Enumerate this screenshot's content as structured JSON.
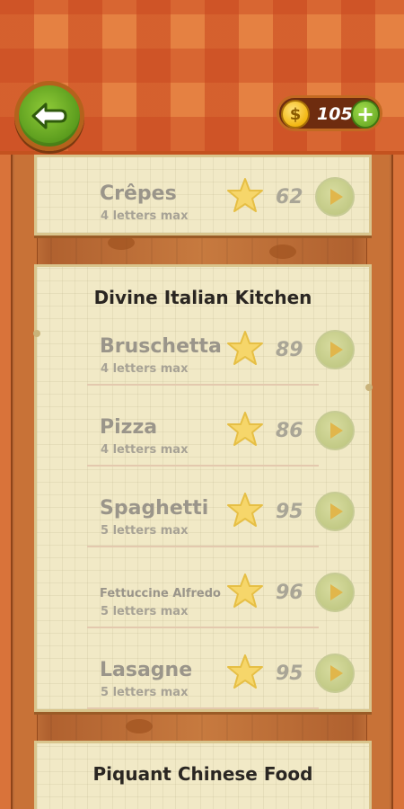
{
  "coins": {
    "value": "105",
    "coin_symbol": "$",
    "plus_symbol": "+"
  },
  "header": {
    "back_icon": "arrow-left-icon"
  },
  "top_partial_level": {
    "name": "Crêpes",
    "sub": "4 letters max",
    "score": "62"
  },
  "section1": {
    "title": "Divine Italian Kitchen",
    "levels": [
      {
        "name": "Bruschetta",
        "sub": "4 letters max",
        "score": "89",
        "small": false
      },
      {
        "name": "Pizza",
        "sub": "4 letters max",
        "score": "86",
        "small": false
      },
      {
        "name": "Spaghetti",
        "sub": "5 letters max",
        "score": "95",
        "small": false
      },
      {
        "name": "Fettuccine Alfredo",
        "sub": "5 letters max",
        "score": "96",
        "small": true
      },
      {
        "name": "Lasagne",
        "sub": "5 letters max",
        "score": "95",
        "small": false
      }
    ]
  },
  "section2": {
    "title": "Piquant Chinese Food"
  },
  "colors": {
    "accent_green": "#5c9d1e",
    "coin_gold": "#f2b712",
    "parchment": "#f1e9c6",
    "tablecloth": "#e58142"
  }
}
